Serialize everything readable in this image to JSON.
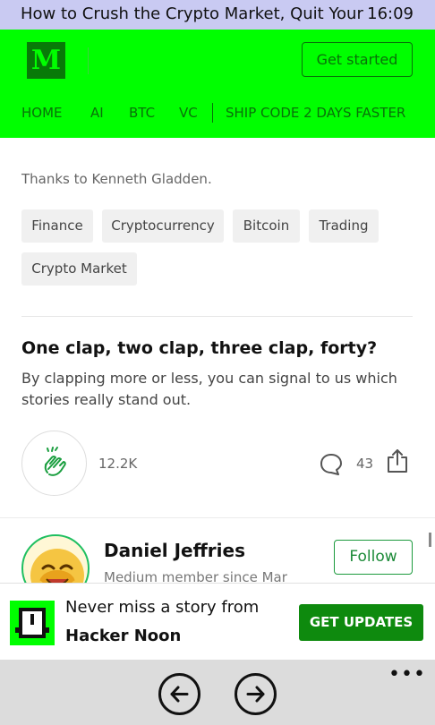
{
  "status_bar": {
    "title": "How to Crush the Crypto Market, Quit Your",
    "time": "16:09"
  },
  "header": {
    "logo_letter": "M",
    "get_started_label": "Get started",
    "nav": [
      "HOME",
      "AI",
      "BTC",
      "VC",
      "SHIP CODE 2 DAYS FASTER"
    ]
  },
  "article": {
    "thanks": "Thanks to Kenneth Gladden.",
    "tags": [
      "Finance",
      "Cryptocurrency",
      "Bitcoin",
      "Trading",
      "Crypto Market"
    ]
  },
  "clap": {
    "heading": "One clap, two clap, three clap, forty?",
    "description": "By clapping more or less, you can signal to us which stories really stand out.",
    "clap_count": "12.2K",
    "comment_count": "43"
  },
  "author": {
    "name": "Daniel Jeffries",
    "meta": "Medium member since Mar",
    "follow_label": "Follow"
  },
  "banner": {
    "line1": "Never miss a story from",
    "line2": "Hacker Noon",
    "button_label": "GET UPDATES"
  },
  "app_bar": {
    "more_label": "•••"
  },
  "colors": {
    "header_green": "#00ff00",
    "dark_green": "#097109",
    "button_green": "#0e8a0e",
    "status_bar": "#c9caf2",
    "app_bar": "#dcdcdc"
  },
  "icons": [
    "clap-icon",
    "comment-icon",
    "share-icon",
    "back-arrow-icon",
    "forward-arrow-icon",
    "hacker-noon-logo-icon"
  ]
}
